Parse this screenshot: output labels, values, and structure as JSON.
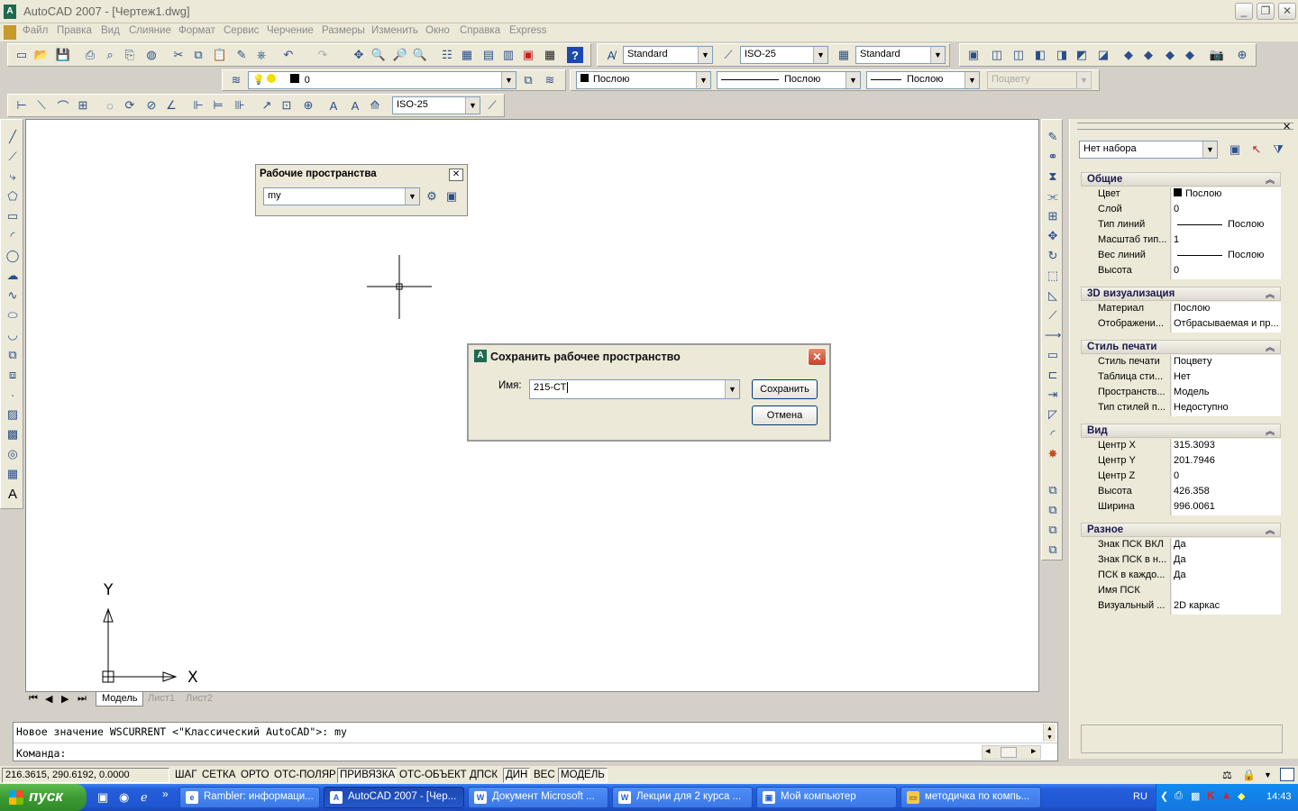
{
  "window": {
    "title": "AutoCAD 2007 - [Чертеж1.dwg]",
    "min": "_",
    "max": "❐",
    "close": "✕"
  },
  "menu": [
    "Файл",
    "Правка",
    "Вид",
    "Слияние",
    "Формат",
    "Сервис",
    "Черчение",
    "Размеры",
    "Изменить",
    "Окно",
    "Справка",
    "Express"
  ],
  "toolbar1": {
    "text_style": "Standard",
    "dim_style": "ISO-25",
    "table_style": "Standard"
  },
  "toolbar2": {
    "layer": "0",
    "color": "Послою",
    "linetype": "Послою",
    "lineweight": "Послою",
    "plotstyle": "Поцвету"
  },
  "toolbar3": {
    "dim_style": "ISO-25"
  },
  "workspaces_palette": {
    "title": "Рабочие пространства",
    "value": "my"
  },
  "save_dialog": {
    "title": "Сохранить рабочее пространство",
    "name_label": "Имя:",
    "name_value": "215-СТ",
    "save": "Сохранить",
    "cancel": "Отмена"
  },
  "canvas": {
    "ucs_x": "X",
    "ucs_y": "Y"
  },
  "layout_tabs": [
    "Модель",
    "Лист1",
    "Лист2"
  ],
  "properties": {
    "selection": "Нет набора",
    "sections": [
      {
        "title": "Общие",
        "rows": [
          [
            "Цвет",
            "Послою"
          ],
          [
            "Слой",
            "0"
          ],
          [
            "Тип линий",
            "Послою"
          ],
          [
            "Масштаб тип...",
            "1"
          ],
          [
            "Вес линий",
            "Послою"
          ],
          [
            "Высота",
            "0"
          ]
        ]
      },
      {
        "title": "3D визуализация",
        "rows": [
          [
            "Материал",
            "Послою"
          ],
          [
            "Отображени...",
            "Отбрасываемая и пр..."
          ]
        ]
      },
      {
        "title": "Стиль печати",
        "rows": [
          [
            "Стиль печати",
            "Поцвету"
          ],
          [
            "Таблица сти...",
            "Нет"
          ],
          [
            "Пространств...",
            "Модель"
          ],
          [
            "Тип стилей п...",
            "Недоступно"
          ]
        ]
      },
      {
        "title": "Вид",
        "rows": [
          [
            "Центр X",
            "315.3093"
          ],
          [
            "Центр Y",
            "201.7946"
          ],
          [
            "Центр Z",
            "0"
          ],
          [
            "Высота",
            "426.358"
          ],
          [
            "Ширина",
            "996.0061"
          ]
        ]
      },
      {
        "title": "Разное",
        "rows": [
          [
            "Знак ПСК ВКЛ",
            "Да"
          ],
          [
            "Знак ПСК в н...",
            "Да"
          ],
          [
            "ПСК в каждо...",
            "Да"
          ],
          [
            "Имя ПСК",
            ""
          ],
          [
            "Визуальный ...",
            "2D каркас"
          ]
        ]
      }
    ]
  },
  "command": {
    "history": "Новое значение WSCURRENT <\"Классический AutoCAD\">: my",
    "prompt": "Команда:"
  },
  "status": {
    "coords": "216.3615,  290.6192, 0.0000",
    "buttons": [
      "ШАГ",
      "СЕТКА",
      "ОРТО",
      "ОТС-ПОЛЯР",
      "ПРИВЯЗКА",
      "ОТС-ОБЪЕКТ",
      "ДПСК",
      "ДИН",
      "ВЕС",
      "МОДЕЛЬ"
    ],
    "active": [
      "ПРИВЯЗКА",
      "ДИН",
      "МОДЕЛЬ"
    ]
  },
  "taskbar": {
    "start": "пуск",
    "tasks": [
      "Rambler: информаци...",
      "AutoCAD 2007 - [Чер...",
      "Документ Microsoft ...",
      "Лекции для 2 курса ...",
      "Мой компьютер",
      "методичка по компь..."
    ],
    "lang": "RU",
    "time": "14:43"
  }
}
